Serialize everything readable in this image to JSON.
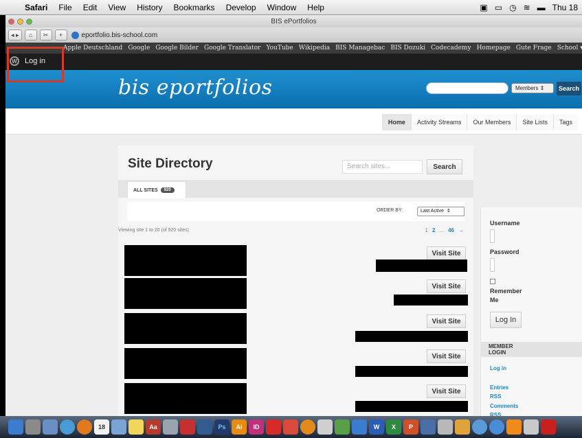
{
  "menubar": {
    "app": "Safari",
    "items": [
      "File",
      "Edit",
      "View",
      "History",
      "Bookmarks",
      "Develop",
      "Window",
      "Help"
    ],
    "clock": "Thu 18"
  },
  "window": {
    "title": "BIS ePortfolios"
  },
  "toolbar": {
    "url": "eportfolio.bis-school.com"
  },
  "bookmarks": [
    "Apple Deutschland",
    "Google",
    "Google Bilder",
    "Google Translator",
    "YouTube",
    "Wikipedia",
    "BIS Managebac",
    "BIS Dozuki",
    "Codecademy",
    "Homepage",
    "Gute Frage",
    "School ▾"
  ],
  "adminbar": {
    "login_label": "Log in"
  },
  "header": {
    "logo": "bis eportfolios",
    "search_select": "Members",
    "search_button": "Search"
  },
  "nav": {
    "tabs": [
      "Home",
      "Activity Streams",
      "Our Members",
      "Site Lists",
      "Tags"
    ]
  },
  "directory": {
    "title": "Site Directory",
    "search_placeholder": "Search sites...",
    "search_button": "Search",
    "tab_label": "ALL SITES",
    "tab_count": "920",
    "order_label": "ORDER BY:",
    "order_value": "Last Active",
    "viewing": "Viewing site 1 to 20 (of 920 sites)",
    "pager": [
      "1",
      "2",
      "...",
      "46",
      "→"
    ],
    "visit_label": "Visit Site"
  },
  "sidebar": {
    "username": "Username",
    "password": "Password",
    "remember": "Remember Me",
    "login": "Log In",
    "member_login": "MEMBER LOGIN",
    "links": [
      "Log in",
      "Entries RSS",
      "Comments RSS"
    ]
  },
  "colors": {
    "header_blue": "#1284c6",
    "link_blue": "#1e87c8",
    "highlight_red": "#d33b2c"
  }
}
